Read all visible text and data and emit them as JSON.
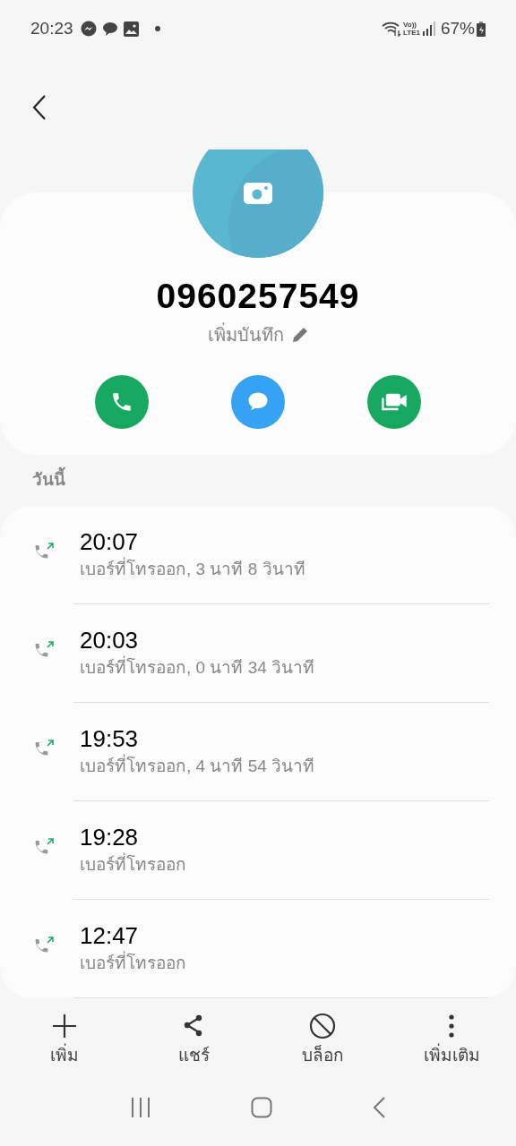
{
  "status_bar": {
    "time": "20:23",
    "volte": "Vo))",
    "network": "LTE1",
    "battery": "67%"
  },
  "contact": {
    "number": "0960257549",
    "note": "เพิ่มบันทึก"
  },
  "actions": [
    {
      "kind": "call",
      "color": "#17a862"
    },
    {
      "kind": "message",
      "color": "#35a2f4"
    },
    {
      "kind": "video",
      "color": "#17a862"
    }
  ],
  "section": "วันนี้",
  "calls": [
    {
      "time": "20:07",
      "detail": "เบอร์ที่โทรออก, 3 นาที 8 วินาที"
    },
    {
      "time": "20:03",
      "detail": "เบอร์ที่โทรออก, 0 นาที 34 วินาที"
    },
    {
      "time": "19:53",
      "detail": "เบอร์ที่โทรออก, 4 นาที 54 วินาที"
    },
    {
      "time": "19:28",
      "detail": "เบอร์ที่โทรออก"
    },
    {
      "time": "12:47",
      "detail": "เบอร์ที่โทรออก"
    }
  ],
  "toolbar": [
    {
      "kind": "add",
      "label": "เพิ่ม"
    },
    {
      "kind": "share",
      "label": "แชร์"
    },
    {
      "kind": "block",
      "label": "บล็อก"
    },
    {
      "kind": "more",
      "label": "เพิ่มเติม"
    }
  ]
}
